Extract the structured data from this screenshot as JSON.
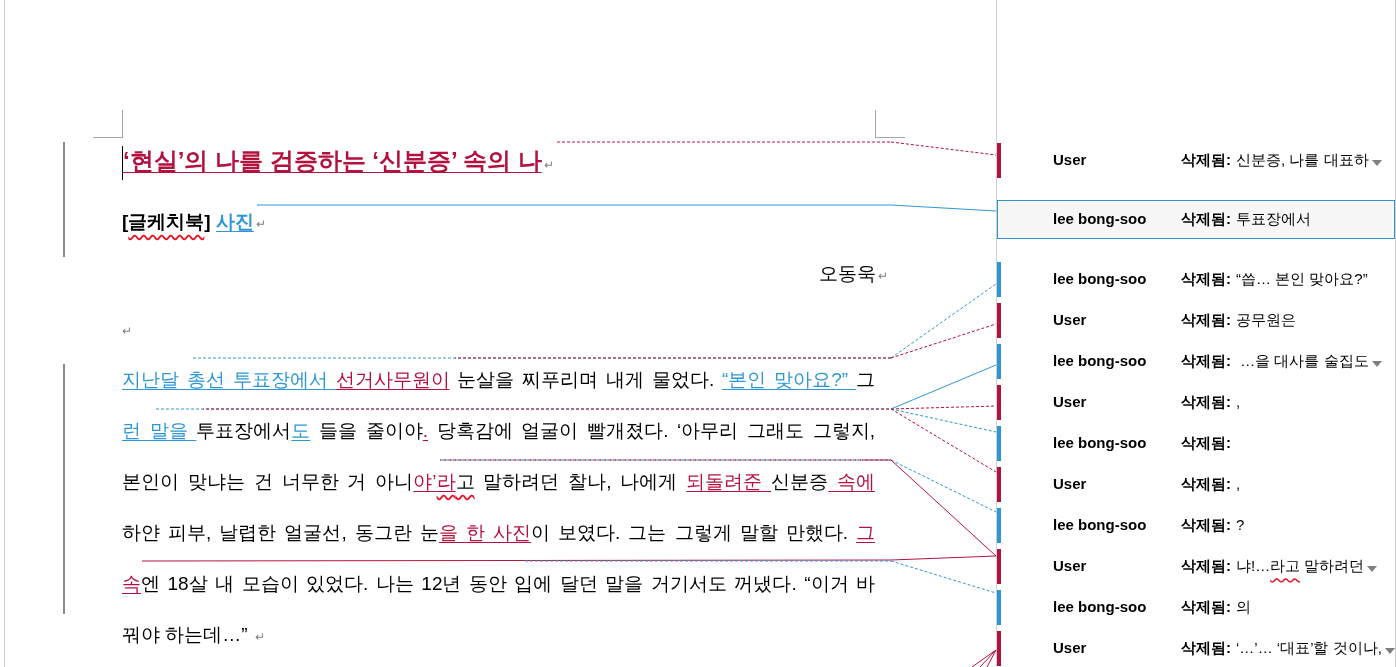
{
  "document": {
    "title": {
      "segments": [
        {
          "text": "‘현실’의 나를 검증하는 ‘신분증’ 속의 나",
          "color": "#b4123e"
        }
      ],
      "end_mark": "↵"
    },
    "subtitle": {
      "segments": [
        {
          "text": "[",
          "misspelled": false
        },
        {
          "text": "글케치북",
          "misspelled": true
        },
        {
          "text": "]  ",
          "misspelled": false
        },
        {
          "text": "사진",
          "color": "#2e97d3",
          "misspelled": false
        }
      ],
      "end_mark": "↵"
    },
    "byline": {
      "text": "오동욱",
      "end_mark": "↵"
    },
    "empty_paragraph": {
      "end_mark": "↵"
    },
    "body": {
      "lines": [
        {
          "segments": [
            {
              "text": "지난달 총선 투표장에서 ",
              "color": "#2e97d3"
            },
            {
              "text": "선거사무원이",
              "color": "#b4123e"
            },
            {
              "text": " 눈살을 찌푸리며 내게 물었다. "
            },
            {
              "text": "“본인 맞아요?” ",
              "color": "#2e97d3"
            },
            {
              "text": "그"
            }
          ]
        },
        {
          "segments": [
            {
              "text": "런 말을 ",
              "color": "#2e97d3"
            },
            {
              "text": "투표장에서"
            },
            {
              "text": "도",
              "color": "#2e97d3"
            },
            {
              "text": " 들을 줄이야"
            },
            {
              "text": ".",
              "color": "#b4123e"
            },
            {
              "text": " 당혹감에 얼굴이 빨개졌다. ‘아무리 그래도 그렇지,"
            }
          ]
        },
        {
          "segments": [
            {
              "text": "본인이 맞냐는 건 너무한 거 아니",
              "misspelled": false
            },
            {
              "text": "야’",
              "color": "#b4123e",
              "misspelled": false
            },
            {
              "text": "라",
              "color": "#b4123e",
              "misspelled": true
            },
            {
              "text": "고",
              "misspelled": true
            },
            {
              "text": " 말하려던 찰나, 나에게 ",
              "misspelled": false
            },
            {
              "text": "되돌려준 ",
              "color": "#b4123e",
              "misspelled": false
            },
            {
              "text": "신분증",
              "misspelled": false
            },
            {
              "text": " 속에",
              "color": "#b4123e",
              "misspelled": false
            }
          ]
        },
        {
          "segments": [
            {
              "text": "하얀 피부, 날렵한 얼굴선, 동그란 눈"
            },
            {
              "text": "을 한 사진",
              "color": "#b4123e"
            },
            {
              "text": "이 보였다. 그는 그렇게 말할 만했다. "
            },
            {
              "text": "그",
              "color": "#b4123e"
            }
          ]
        },
        {
          "segments": [
            {
              "text": "속",
              "color": "#b4123e"
            },
            {
              "text": "엔 18살 내 모습이 있었다. 나는 12년 동안 입에 달던 말을 거기서도 꺼냈다. “이거 바"
            }
          ]
        },
        {
          "segments": [
            {
              "text": "꿔야 하는데…” "
            }
          ]
        }
      ],
      "end_mark": "↵"
    }
  },
  "balloons": [
    {
      "author": "User",
      "label": "삭제됨:",
      "deleted": [
        {
          "text": "신분증, 나를 대표하"
        }
      ],
      "color": "#b4123e",
      "selected": false,
      "truncated": true
    },
    {
      "author": "lee bong-soo",
      "label": "삭제됨:",
      "deleted": [
        {
          "text": "투표장에서"
        }
      ],
      "color": "#2e97d3",
      "selected": true,
      "truncated": false
    },
    {
      "author": "lee bong-soo",
      "label": "삭제됨:",
      "deleted": [
        {
          "text": "“씁… 본인 맞아요?”"
        }
      ],
      "color": "#2e97d3",
      "selected": false,
      "truncated": false
    },
    {
      "author": "User",
      "label": "삭제됨:",
      "deleted": [
        {
          "text": "공무원은"
        }
      ],
      "color": "#b4123e",
      "selected": false,
      "truncated": false
    },
    {
      "author": "lee bong-soo",
      "label": "삭제됨:",
      "deleted": [
        {
          "text": " …을 대사를 술집도"
        }
      ],
      "color": "#2e97d3",
      "selected": false,
      "truncated": true
    },
    {
      "author": "User",
      "label": "삭제됨:",
      "deleted": [
        {
          "text": ","
        }
      ],
      "color": "#b4123e",
      "selected": false,
      "truncated": false
    },
    {
      "author": "lee bong-soo",
      "label": "삭제됨:",
      "color": "#2e97d3",
      "selected": false,
      "truncated": false
    },
    {
      "author": "User",
      "label": "삭제됨:",
      "deleted": [
        {
          "text": ","
        }
      ],
      "color": "#b4123e",
      "selected": false,
      "truncated": false
    },
    {
      "author": "lee bong-soo",
      "label": "삭제됨:",
      "deleted": [
        {
          "text": "?"
        }
      ],
      "color": "#2e97d3",
      "selected": false,
      "truncated": false
    },
    {
      "author": "User",
      "label": "삭제됨:",
      "deleted": [
        {
          "text": "냐!…",
          "misspelled": false
        },
        {
          "text": "라고",
          "misspelled": true
        },
        {
          "text": " 말하려던",
          "misspelled": false
        }
      ],
      "color": "#b4123e",
      "selected": false,
      "truncated": true
    },
    {
      "author": "lee bong-soo",
      "label": "삭제됨:",
      "deleted": [
        {
          "text": "의"
        }
      ],
      "color": "#2e97d3",
      "selected": false,
      "truncated": false
    },
    {
      "author": "User",
      "label": "삭제됨:",
      "deleted": [
        {
          "text": "‘…’… ‘대표’할 것이나,"
        }
      ],
      "color": "#b4123e",
      "selected": false,
      "truncated": true
    }
  ]
}
